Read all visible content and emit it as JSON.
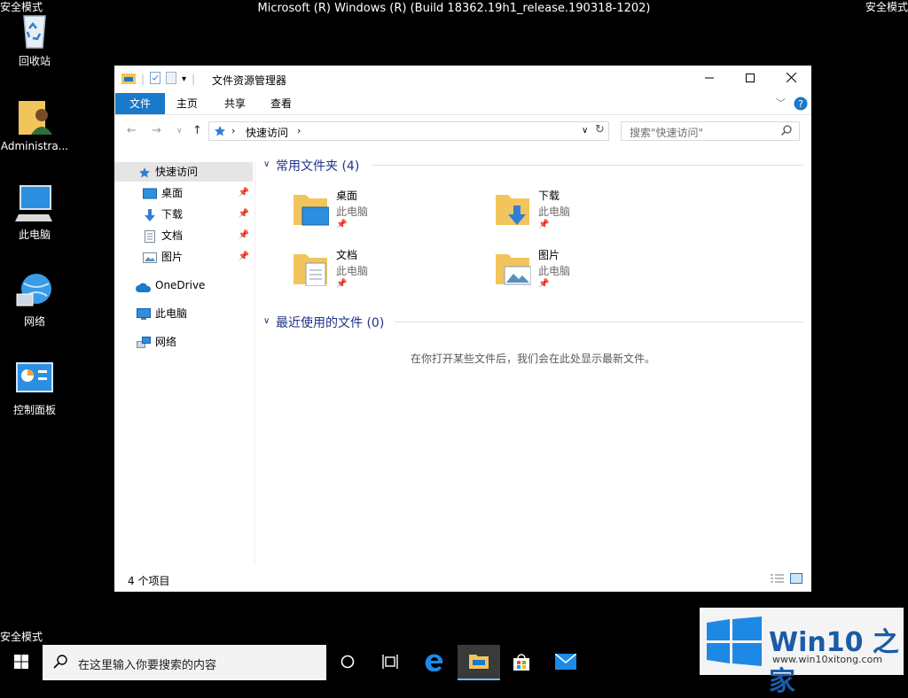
{
  "safe_mode": "安全模式",
  "build_text": "Microsoft (R) Windows (R) (Build 18362.19h1_release.190318-1202)",
  "desktop_icons": [
    {
      "label": "回收站"
    },
    {
      "label": "Administra..."
    },
    {
      "label": "此电脑"
    },
    {
      "label": "网络"
    },
    {
      "label": "控制面板"
    }
  ],
  "window": {
    "title": "文件资源管理器",
    "ribbon_tabs": [
      "文件",
      "主页",
      "共享",
      "查看"
    ],
    "address_path": "快速访问",
    "search_placeholder": "搜索\"快速访问\"",
    "nav_items": [
      {
        "label": "快速访问",
        "icon": "star-icon"
      },
      {
        "label": "桌面",
        "icon": "desktop-icon"
      },
      {
        "label": "下载",
        "icon": "download-icon"
      },
      {
        "label": "文档",
        "icon": "document-icon"
      },
      {
        "label": "图片",
        "icon": "pictures-icon"
      },
      {
        "label": "OneDrive",
        "icon": "cloud-icon"
      },
      {
        "label": "此电脑",
        "icon": "computer-icon"
      },
      {
        "label": "网络",
        "icon": "network-icon"
      }
    ],
    "frequent_header": "常用文件夹 (4)",
    "folders": [
      {
        "name": "桌面",
        "location": "此电脑"
      },
      {
        "name": "下载",
        "location": "此电脑"
      },
      {
        "name": "文档",
        "location": "此电脑"
      },
      {
        "name": "图片",
        "location": "此电脑"
      }
    ],
    "recent_header": "最近使用的文件 (0)",
    "recent_empty": "在你打开某些文件后，我们会在此处显示最新文件。",
    "status_text": "4 个项目"
  },
  "taskbar": {
    "search_placeholder": "在这里输入你要搜索的内容"
  },
  "watermark": {
    "brand": "Win10 之家",
    "url": "www.win10xitong.com"
  },
  "colors": {
    "accent": "#1979ca",
    "folder": "#f2c55c",
    "group_header": "#1e3287"
  }
}
